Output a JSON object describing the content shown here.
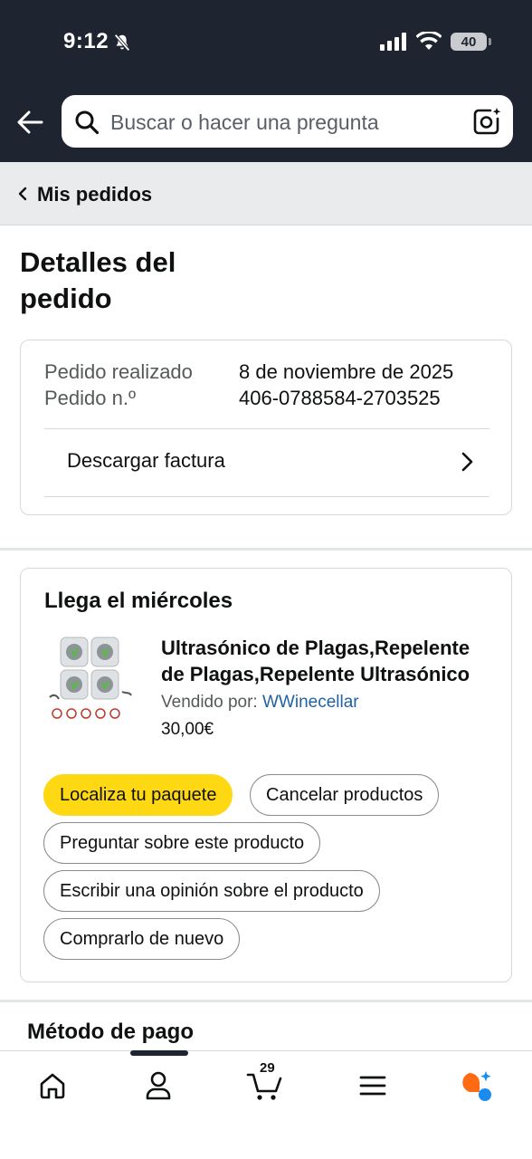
{
  "status_bar": {
    "time": "9:12",
    "battery": "40"
  },
  "search": {
    "placeholder": "Buscar o hacer una pregunta"
  },
  "breadcrumb": {
    "label": "Mis pedidos"
  },
  "page": {
    "title": "Detalles del pedido"
  },
  "order_info": {
    "placed_label": "Pedido realizado",
    "placed_value": "8 de noviembre de 2025",
    "number_label": "Pedido n.º",
    "number_value": "406-0788584-2703525",
    "invoice_label": "Descargar factura"
  },
  "shipment": {
    "title": "Llega el miércoles",
    "product": {
      "title_line1": "Ultrasónico de Plagas,Repelente",
      "title_line2": "de Plagas,Repelente Ultrasónico",
      "sold_by_label": "Vendido por:",
      "seller": "WWinecellar",
      "price": "30,00€"
    },
    "buttons": {
      "track": "Localiza tu paquete",
      "cancel": "Cancelar productos",
      "ask": "Preguntar sobre este producto",
      "review": "Escribir una opinión sobre el producto",
      "buy_again": "Comprarlo de nuevo"
    }
  },
  "payment": {
    "title": "Método de pago"
  },
  "bottom_nav": {
    "cart_count": "29",
    "icons": [
      "home-icon",
      "account-icon",
      "cart-icon",
      "menu-icon",
      "rufus-icon"
    ]
  },
  "colors": {
    "header_bg": "#1e2530",
    "primary_button": "#ffd814",
    "link": "#2162a1"
  }
}
